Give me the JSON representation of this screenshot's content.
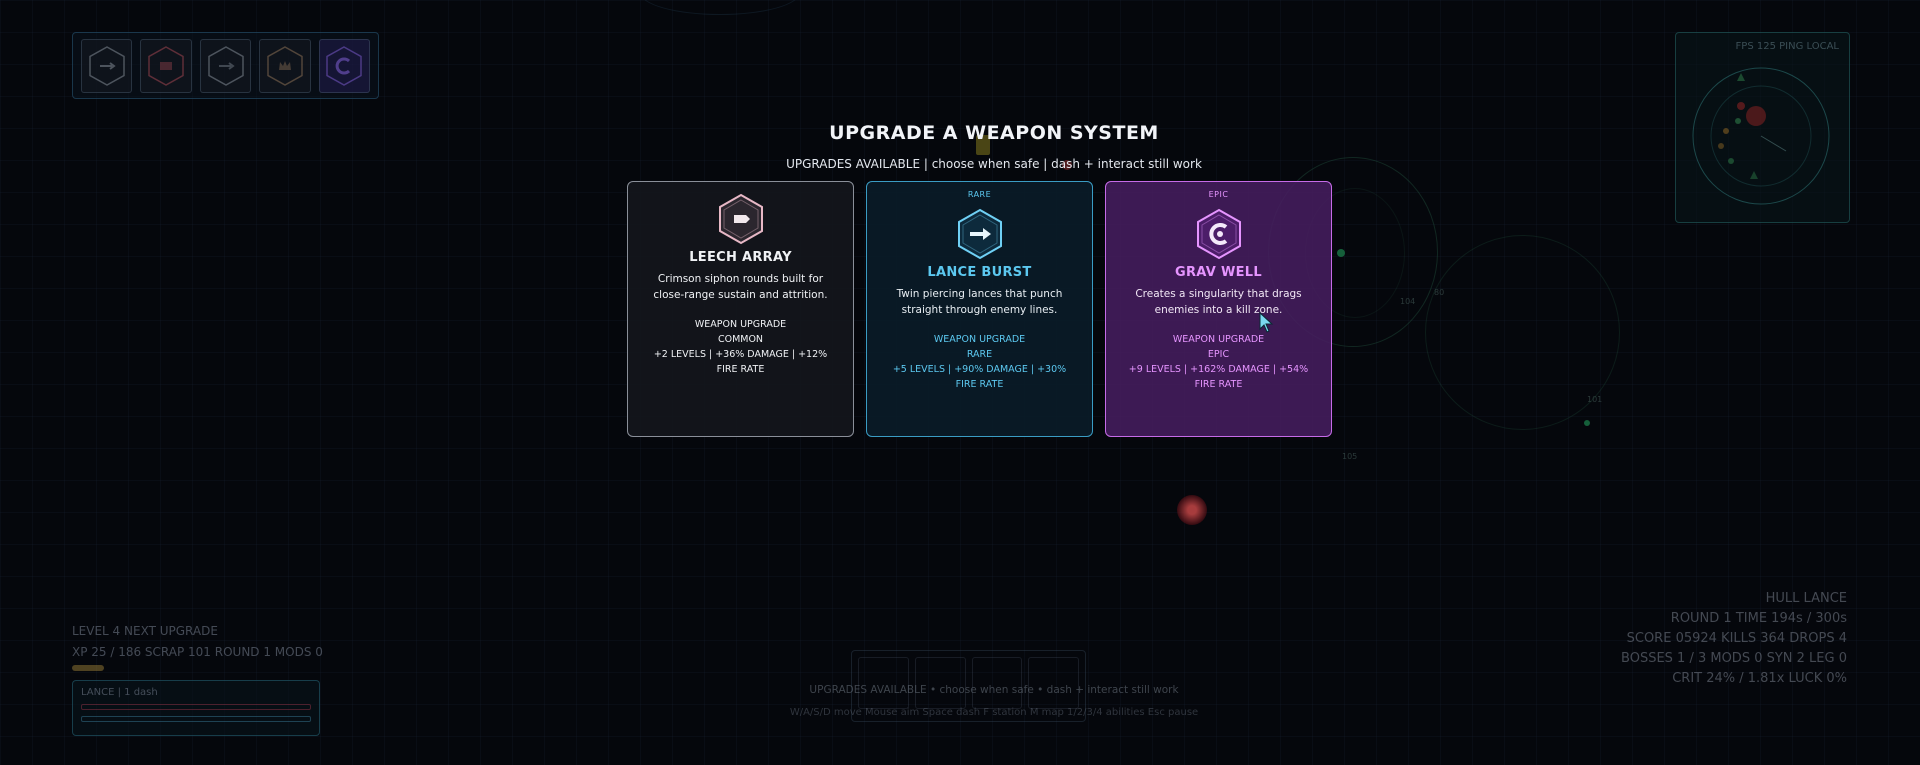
{
  "modal": {
    "title": "UPGRADE A WEAPON SYSTEM",
    "subtitle": "UPGRADES AVAILABLE  |  choose when safe  |  dash + interact still work"
  },
  "cards": [
    {
      "rarity_tag": "",
      "name": "LEECH ARRAY",
      "description": "Crimson siphon rounds built for close-range sustain and attrition.",
      "type": "WEAPON UPGRADE",
      "rarity": "COMMON",
      "stats": "+2 LEVELS  |  +36% DAMAGE  |  +12% FIRE RATE",
      "icon": "leech-array-icon",
      "color": "#8a8f99"
    },
    {
      "rarity_tag": "RARE",
      "name": "LANCE BURST",
      "description": "Twin piercing lances that punch straight through enemy lines.",
      "type": "WEAPON UPGRADE",
      "rarity": "RARE",
      "stats": "+5 LEVELS  |  +90% DAMAGE  |  +30% FIRE RATE",
      "icon": "lance-burst-icon",
      "color": "#3a9cc4"
    },
    {
      "rarity_tag": "EPIC",
      "name": "GRAV WELL",
      "description": "Creates a singularity that drags enemies into a kill zone.",
      "type": "WEAPON UPGRADE",
      "rarity": "EPIC",
      "stats": "+9 LEVELS  |  +162% DAMAGE  |  +54% FIRE RATE",
      "icon": "grav-well-icon",
      "color": "#c66be8"
    }
  ],
  "minimap": {
    "stats": "FPS 125   PING LOCAL"
  },
  "hud_left": {
    "line1": "LEVEL 4   NEXT UPGRADE",
    "line2": "XP 25 / 186   SCRAP 101   ROUND 1   MODS 0",
    "xp_progress": 0.134,
    "weapon_label": "LANCE  |  1 dash"
  },
  "hud_right": {
    "ship": "HULL LANCE",
    "round_time": "ROUND 1   TIME 194s / 300s",
    "score": "SCORE 05924   KILLS 364   DROPS 4",
    "bosses": "BOSSES 1 / 3   MODS 0   SYN 2   LEG 0",
    "crit": "CRIT 24% / 1.81x   LUCK 0%"
  },
  "bottom": {
    "status": "UPGRADES AVAILABLE  •  choose when safe  •  dash + interact still work",
    "controls": "W/A/S/D move   Mouse aim   Space dash   F station   M map   1/2/3/4 abilities   Esc pause"
  },
  "world_labels": [
    "104",
    "105",
    "80",
    "101"
  ],
  "colors": {
    "common": "#8a8f99",
    "rare": "#5cc8f0",
    "epic": "#e695ff",
    "background": "#07090f"
  }
}
